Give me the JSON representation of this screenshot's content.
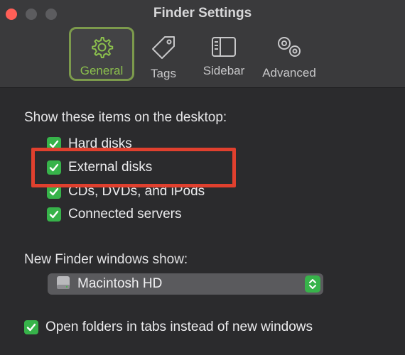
{
  "window": {
    "title": "Finder Settings"
  },
  "tabs": [
    {
      "label": "General",
      "icon": "gear-icon",
      "selected": true
    },
    {
      "label": "Tags",
      "icon": "tag-icon"
    },
    {
      "label": "Sidebar",
      "icon": "sidebar-icon"
    },
    {
      "label": "Advanced",
      "icon": "gears-icon"
    }
  ],
  "desktop": {
    "heading": "Show these items on the desktop:",
    "items": [
      {
        "label": "Hard disks",
        "checked": true
      },
      {
        "label": "External disks",
        "checked": true
      },
      {
        "label": "CDs, DVDs, and iPods",
        "checked": true
      },
      {
        "label": "Connected servers",
        "checked": true
      }
    ]
  },
  "new_windows": {
    "heading": "New Finder windows show:",
    "selected": "Macintosh HD"
  },
  "tabs_option": {
    "label": "Open folders in tabs instead of new windows",
    "checked": true
  },
  "colors": {
    "accent": "#37b34a",
    "highlight": "#e0402e",
    "selected_tab": "#8bbf4d"
  }
}
